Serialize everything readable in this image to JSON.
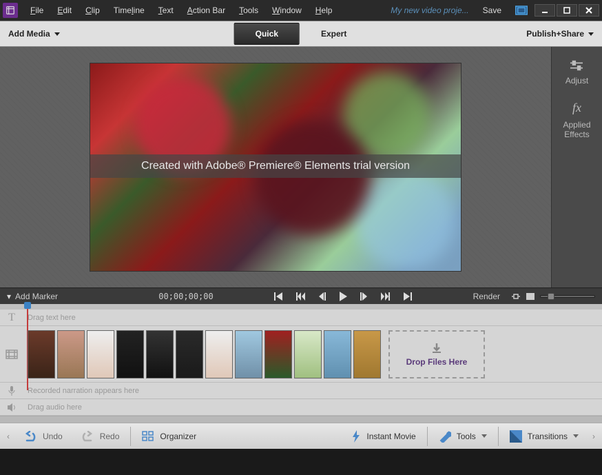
{
  "menu": {
    "items": [
      "File",
      "Edit",
      "Clip",
      "Timeline",
      "Text",
      "Action Bar",
      "Tools",
      "Window",
      "Help"
    ],
    "underline_idx": [
      0,
      0,
      0,
      4,
      0,
      0,
      0,
      0,
      0
    ]
  },
  "project_name": "My new video proje...",
  "save_label": "Save",
  "toolbar": {
    "add_media": "Add Media",
    "modes": [
      "Quick",
      "Expert"
    ],
    "active_mode": 0,
    "publish": "Publish+Share"
  },
  "preview": {
    "watermark": "Created with  Adobe® Premiere® Elements  trial version",
    "side": [
      {
        "icon": "sliders",
        "label": "Adjust"
      },
      {
        "icon": "fx",
        "label": "Applied\nEffects"
      }
    ]
  },
  "playback": {
    "add_marker": "Add Marker",
    "timecode": "00;00;00;00",
    "render": "Render"
  },
  "tracks": {
    "text_placeholder": "Drag text here",
    "narration_placeholder": "Recorded narration appears here",
    "audio_placeholder": "Drag audio here",
    "drop_label": "Drop Files Here",
    "clips": [
      {
        "bg": "linear-gradient(#6b3a2a,#3a2418)"
      },
      {
        "bg": "linear-gradient(#c98,#975)"
      },
      {
        "bg": "linear-gradient(#eee,#e0c8b8)"
      },
      {
        "bg": "linear-gradient(#222,#111)"
      },
      {
        "bg": "linear-gradient(#333,#111)"
      },
      {
        "bg": "linear-gradient(#2a2a2a,#1a1a1a)"
      },
      {
        "bg": "linear-gradient(#eee,#e0c8b8)"
      },
      {
        "bg": "linear-gradient(#a0c8e0,#7090a8)"
      },
      {
        "bg": "linear-gradient(#a02020,#2a5a2a)"
      },
      {
        "bg": "linear-gradient(#d8e8c8,#a0c080)"
      },
      {
        "bg": "linear-gradient(#88b8d8,#6090b0)"
      },
      {
        "bg": "linear-gradient(#c89848,#a07830)"
      }
    ]
  },
  "bottom": {
    "undo": "Undo",
    "redo": "Redo",
    "organizer": "Organizer",
    "instant_movie": "Instant Movie",
    "tools": "Tools",
    "transitions": "Transitions"
  }
}
